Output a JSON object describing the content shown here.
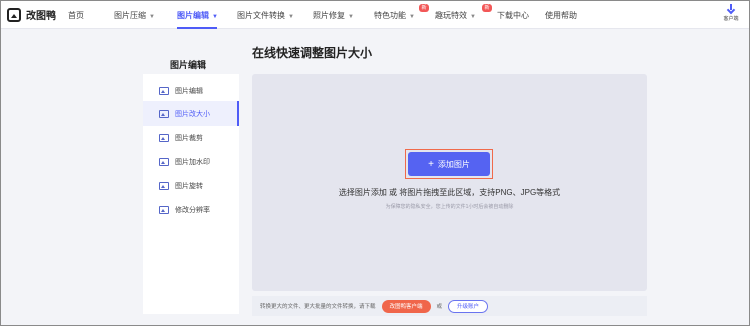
{
  "brand": {
    "name": "改图鸭"
  },
  "nav": {
    "items": [
      {
        "label": "首页"
      },
      {
        "label": "图片压缩"
      },
      {
        "label": "图片编辑"
      },
      {
        "label": "图片文件转换"
      },
      {
        "label": "照片修复"
      },
      {
        "label": "特色功能"
      },
      {
        "label": "趣玩特效"
      },
      {
        "label": "下载中心"
      },
      {
        "label": "使用帮助"
      }
    ],
    "badge": "新",
    "client_label": "客户端"
  },
  "sidebar": {
    "title": "图片编辑",
    "items": [
      {
        "label": "图片编辑"
      },
      {
        "label": "图片改大小"
      },
      {
        "label": "图片裁剪"
      },
      {
        "label": "图片加水印"
      },
      {
        "label": "图片旋转"
      },
      {
        "label": "修改分辨率"
      }
    ],
    "active_index": 1
  },
  "main": {
    "title": "在线快速调整图片大小",
    "upload_button": "添加图片",
    "hint": "选择图片添加 或 将图片拖拽至此区域，支持PNG、JPG等格式",
    "note": "为保障您的隐私安全，您上传的文件1小时后会被自动删除"
  },
  "bottom": {
    "text": "转换更大的文件、更大批量的文件转换，请下载",
    "client_button": "改图鸭客户端",
    "or": "或",
    "upgrade_button": "升级账户"
  },
  "colors": {
    "accent": "#4f5cf7",
    "primary_button": "#5563f2",
    "highlight": "#f0664b"
  }
}
